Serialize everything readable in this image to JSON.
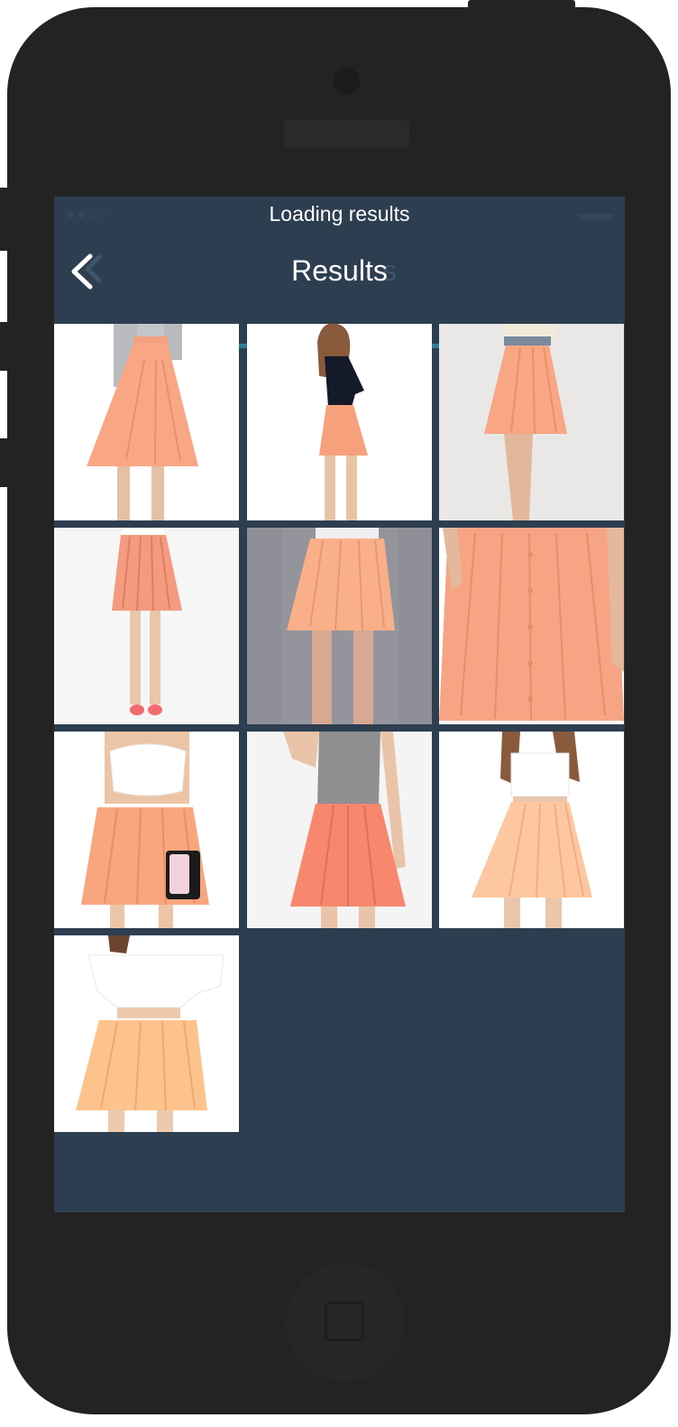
{
  "status_bar": {
    "message": "Loading results"
  },
  "nav": {
    "title": "Results"
  },
  "colors": {
    "header_bg": "#2d3e50",
    "progress": "#2c8095",
    "skirt": "#f8a684"
  },
  "icons": {
    "back": "chevron-left-icon"
  },
  "results": [
    {
      "id": 1
    },
    {
      "id": 2
    },
    {
      "id": 3
    },
    {
      "id": 4
    },
    {
      "id": 5
    },
    {
      "id": 6
    },
    {
      "id": 7
    },
    {
      "id": 8
    },
    {
      "id": 9
    },
    {
      "id": 10
    }
  ]
}
